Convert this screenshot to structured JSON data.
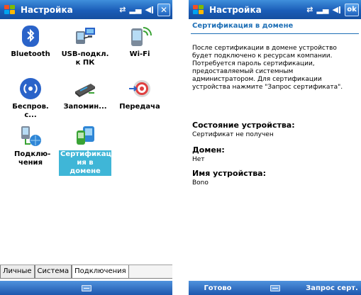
{
  "left": {
    "title": "Настройка",
    "status_icons": [
      "signal-icon",
      "speaker-icon",
      "sync-icon"
    ],
    "close_label": "✕",
    "items": [
      {
        "label": "Bluetooth",
        "icon": "bluetooth-icon"
      },
      {
        "label": "USB-подкл. к ПК",
        "icon": "usb-pc-icon"
      },
      {
        "label": "Wi-Fi",
        "icon": "wifi-icon"
      },
      {
        "label": "Беспров. с...",
        "icon": "wireless-icon"
      },
      {
        "label": "Запомин...",
        "icon": "storage-icon"
      },
      {
        "label": "Передача",
        "icon": "beam-icon"
      },
      {
        "label": "Подклю- чения",
        "icon": "connections-icon"
      },
      {
        "label": "Сертификац ия в домене",
        "icon": "domain-cert-icon",
        "selected": true
      }
    ],
    "tabs": [
      "Личные",
      "Система",
      "Подключения"
    ],
    "active_tab": "Подключения"
  },
  "right": {
    "title": "Настройка",
    "ok_label": "ok",
    "header": "Сертификация в домене",
    "description": "После сертификации в домене устройство будет подключено к ресурсам компании. Потребуется пароль сертификации, предоставляемый системным администратором. Для сертификации устройства нажмите \"Запрос сертификата\".",
    "device_state_label": "Состояние устройства:",
    "device_state_value": "Сертификат не получен",
    "domain_label": "Домен:",
    "domain_value": "Нет",
    "device_name_label": "Имя устройства:",
    "device_name_value": "Bono",
    "softkey_left": "Готово",
    "softkey_right": "Запрос серт."
  },
  "colors": {
    "titlebar": "#1b5db8",
    "selection": "#3fb6d7",
    "header": "#1e6fb6"
  }
}
